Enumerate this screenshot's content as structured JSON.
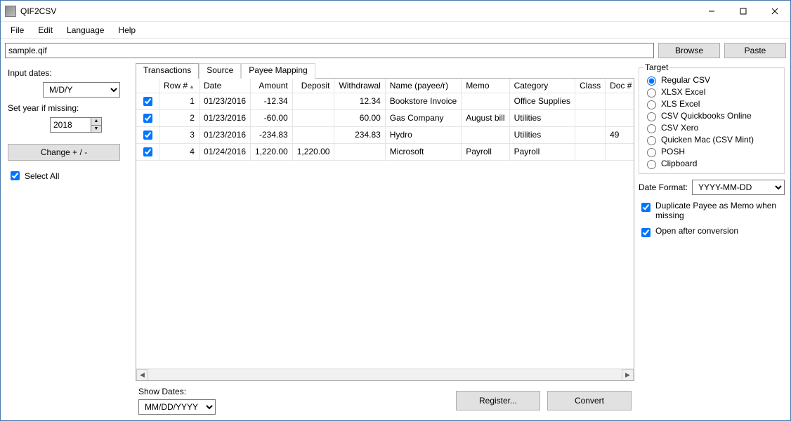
{
  "window": {
    "title": "QIF2CSV"
  },
  "menu": {
    "file": "File",
    "edit": "Edit",
    "language": "Language",
    "help": "Help"
  },
  "filebar": {
    "path": "sample.qif",
    "browse": "Browse",
    "paste": "Paste"
  },
  "left": {
    "input_dates_label": "Input dates:",
    "input_dates_value": "M/D/Y",
    "set_year_label": "Set year if missing:",
    "year_value": "2018",
    "change_button": "Change + / -",
    "select_all": "Select All"
  },
  "tabs": {
    "transactions": "Transactions",
    "source": "Source",
    "payee": "Payee Mapping"
  },
  "grid": {
    "headers": {
      "row": "Row #",
      "date": "Date",
      "amount": "Amount",
      "deposit": "Deposit",
      "withdrawal": "Withdrawal",
      "name": "Name (payee/r)",
      "memo": "Memo",
      "category": "Category",
      "class": "Class",
      "doc": "Doc #"
    },
    "rows": [
      {
        "row": "1",
        "date": "01/23/2016",
        "amount": "-12.34",
        "deposit": "",
        "withdrawal": "12.34",
        "name": "Bookstore Invoice",
        "memo": "",
        "category": "Office Supplies",
        "class": "",
        "doc": ""
      },
      {
        "row": "2",
        "date": "01/23/2016",
        "amount": "-60.00",
        "deposit": "",
        "withdrawal": "60.00",
        "name": "Gas Company",
        "memo": "August bill",
        "category": "Utilities",
        "class": "",
        "doc": ""
      },
      {
        "row": "3",
        "date": "01/23/2016",
        "amount": "-234.83",
        "deposit": "",
        "withdrawal": "234.83",
        "name": "Hydro",
        "memo": "",
        "category": "Utilities",
        "class": "",
        "doc": "49"
      },
      {
        "row": "4",
        "date": "01/24/2016",
        "amount": "1,220.00",
        "deposit": "1,220.00",
        "withdrawal": "",
        "name": "Microsoft",
        "memo": "Payroll",
        "category": "Payroll",
        "class": "",
        "doc": ""
      }
    ]
  },
  "bottom": {
    "show_dates_label": "Show Dates:",
    "show_dates_value": "MM/DD/YYYY",
    "register": "Register...",
    "convert": "Convert"
  },
  "right": {
    "target_legend": "Target",
    "targets": [
      "Regular CSV",
      "XLSX Excel",
      "XLS Excel",
      "CSV Quickbooks Online",
      "CSV Xero",
      "Quicken Mac (CSV Mint)",
      "POSH",
      "Clipboard"
    ],
    "date_format_label": "Date Format:",
    "date_format_value": "YYYY-MM-DD",
    "dup_payee": "Duplicate Payee as Memo when missing",
    "open_after": "Open after conversion"
  }
}
